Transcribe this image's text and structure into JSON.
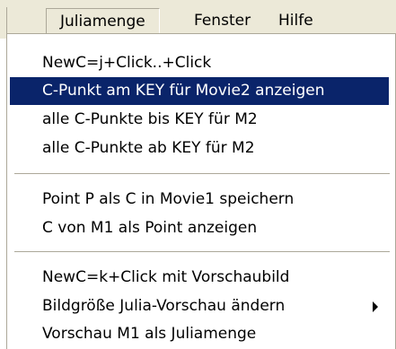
{
  "menubar": {
    "items": [
      {
        "label": "Juliamenge",
        "open": true
      },
      {
        "label": "Fenster"
      },
      {
        "label": "Hilfe"
      }
    ]
  },
  "menu": {
    "groups": [
      {
        "items": [
          {
            "label": "NewC=j+Click..+Click"
          },
          {
            "label": "C-Punkt am KEY für Movie2 anzeigen",
            "selected": true
          },
          {
            "label": "alle C-Punkte bis KEY für M2"
          },
          {
            "label": "alle C-Punkte ab KEY für M2"
          }
        ]
      },
      {
        "items": [
          {
            "label": "Point P als C in Movie1 speichern"
          },
          {
            "label": "C von M1 als Point anzeigen"
          }
        ]
      },
      {
        "items": [
          {
            "label": "NewC=k+Click mit Vorschaubild"
          },
          {
            "label": "Bildgröße Julia-Vorschau ändern",
            "submenu_icon": "submenu-arrow-icon"
          },
          {
            "label": "Vorschau M1 als Juliamenge"
          }
        ]
      }
    ]
  },
  "colors": {
    "menubar_bg": "#ece9d8",
    "highlight_bg": "#0a246a",
    "highlight_text": "#ffffff",
    "separator": "#aca899"
  }
}
